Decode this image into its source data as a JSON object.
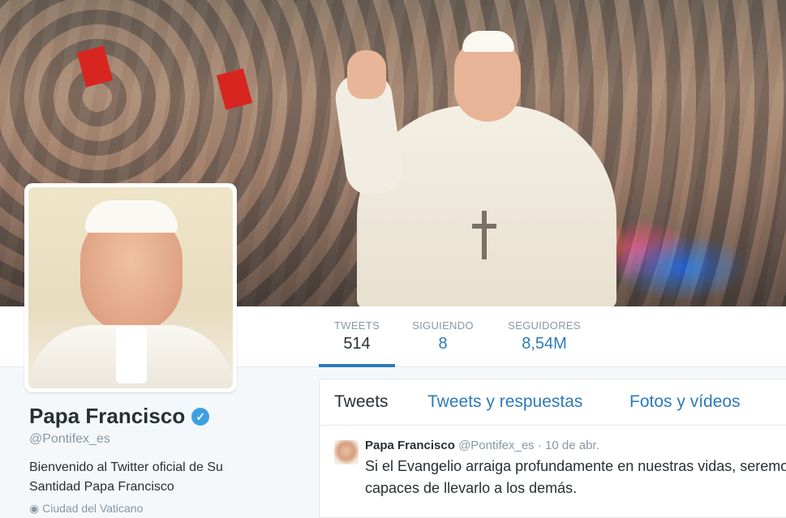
{
  "header": {
    "photo_alt": "Pope waving to crowd"
  },
  "nav": {
    "items": [
      {
        "label": "TWEETS",
        "value": "514"
      },
      {
        "label": "SIGUIENDO",
        "value": "8"
      },
      {
        "label": "SEGUIDORES",
        "value": "8,54M"
      }
    ]
  },
  "profile": {
    "name": "Papa Francisco",
    "handle": "@Pontifex_es",
    "bio": "Bienvenido al Twitter oficial de Su Santidad Papa Francisco",
    "location": "Ciudad del Vaticano"
  },
  "timeline": {
    "tabs": [
      "Tweets",
      "Tweets y respuestas",
      "Fotos y vídeos"
    ],
    "tweet": {
      "author": "Papa Francisco",
      "handle": "@Pontifex_es",
      "separator": "·",
      "date": "10 de abr.",
      "text": "Si el Evangelio arraiga profundamente en nuestras vidas, seremos capaces de llevarlo a los demás."
    }
  },
  "colors": {
    "accent": "#2b7bb9",
    "verified": "#3ea0e4",
    "muted": "#8899a6"
  },
  "icons": [
    "verified-icon",
    "location-icon"
  ]
}
